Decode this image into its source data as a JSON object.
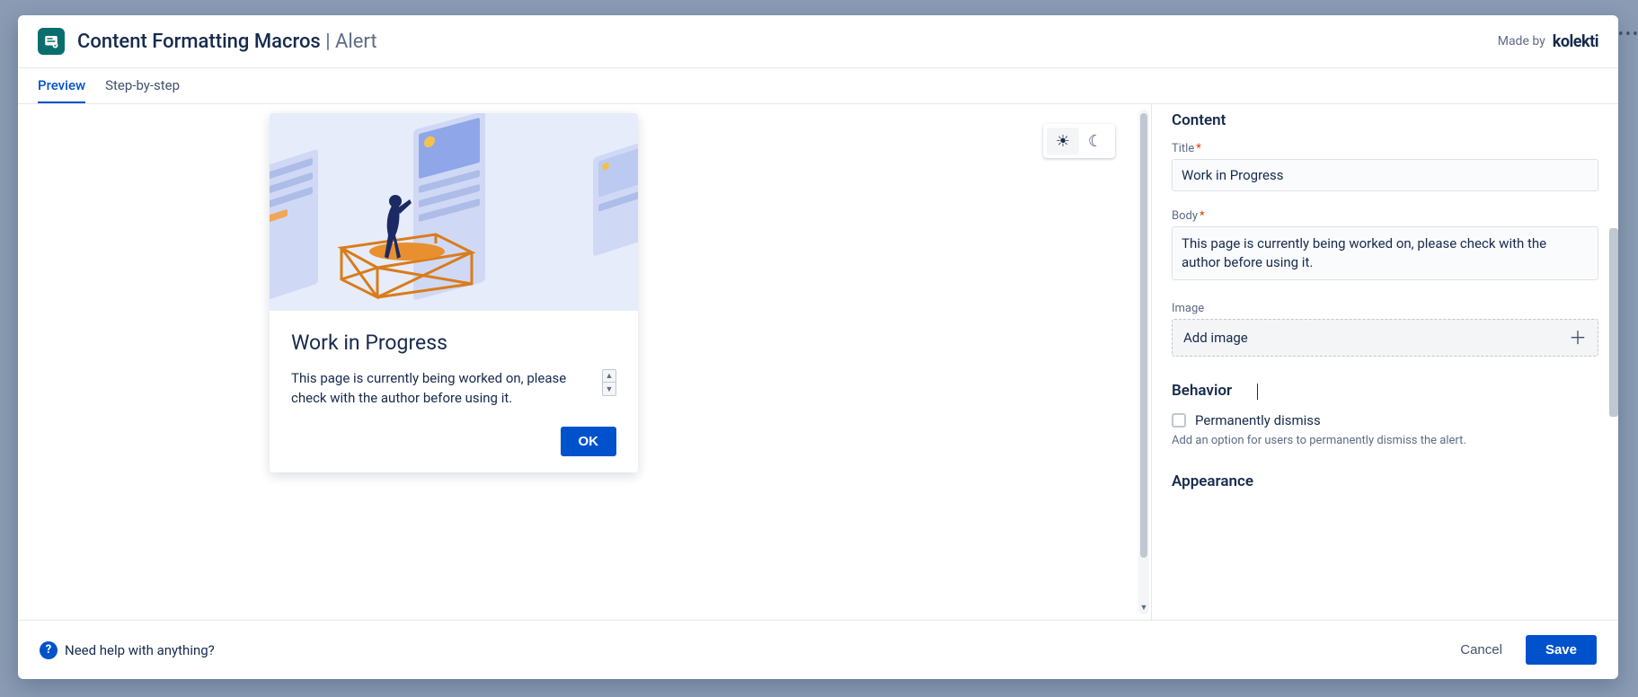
{
  "header": {
    "app_name": "Content Formatting Macros",
    "separator": " | ",
    "macro_name": "Alert",
    "made_by": "Made by",
    "brand": "kolekti"
  },
  "tabs": {
    "preview": "Preview",
    "step_by_step": "Step-by-step"
  },
  "preview": {
    "card_title": "Work in Progress",
    "card_body": "This page is currently being worked on, please check with the author before using it.",
    "ok": "OK"
  },
  "config": {
    "content_section": "Content",
    "title_label": "Title",
    "title_value": "Work in Progress",
    "body_label": "Body",
    "body_value": "This page is currently being worked on, please check with the author before using it.",
    "image_label": "Image",
    "add_image": "Add image",
    "behavior_section": "Behavior",
    "perm_dismiss_label": "Permanently dismiss",
    "perm_dismiss_help": "Add an option for users to permanently dismiss the alert.",
    "appearance_section": "Appearance"
  },
  "footer": {
    "help": "Need help with anything?",
    "cancel": "Cancel",
    "save": "Save"
  },
  "colors": {
    "primary": "#0052cc",
    "text": "#172b4d",
    "muted": "#5e6c84"
  }
}
